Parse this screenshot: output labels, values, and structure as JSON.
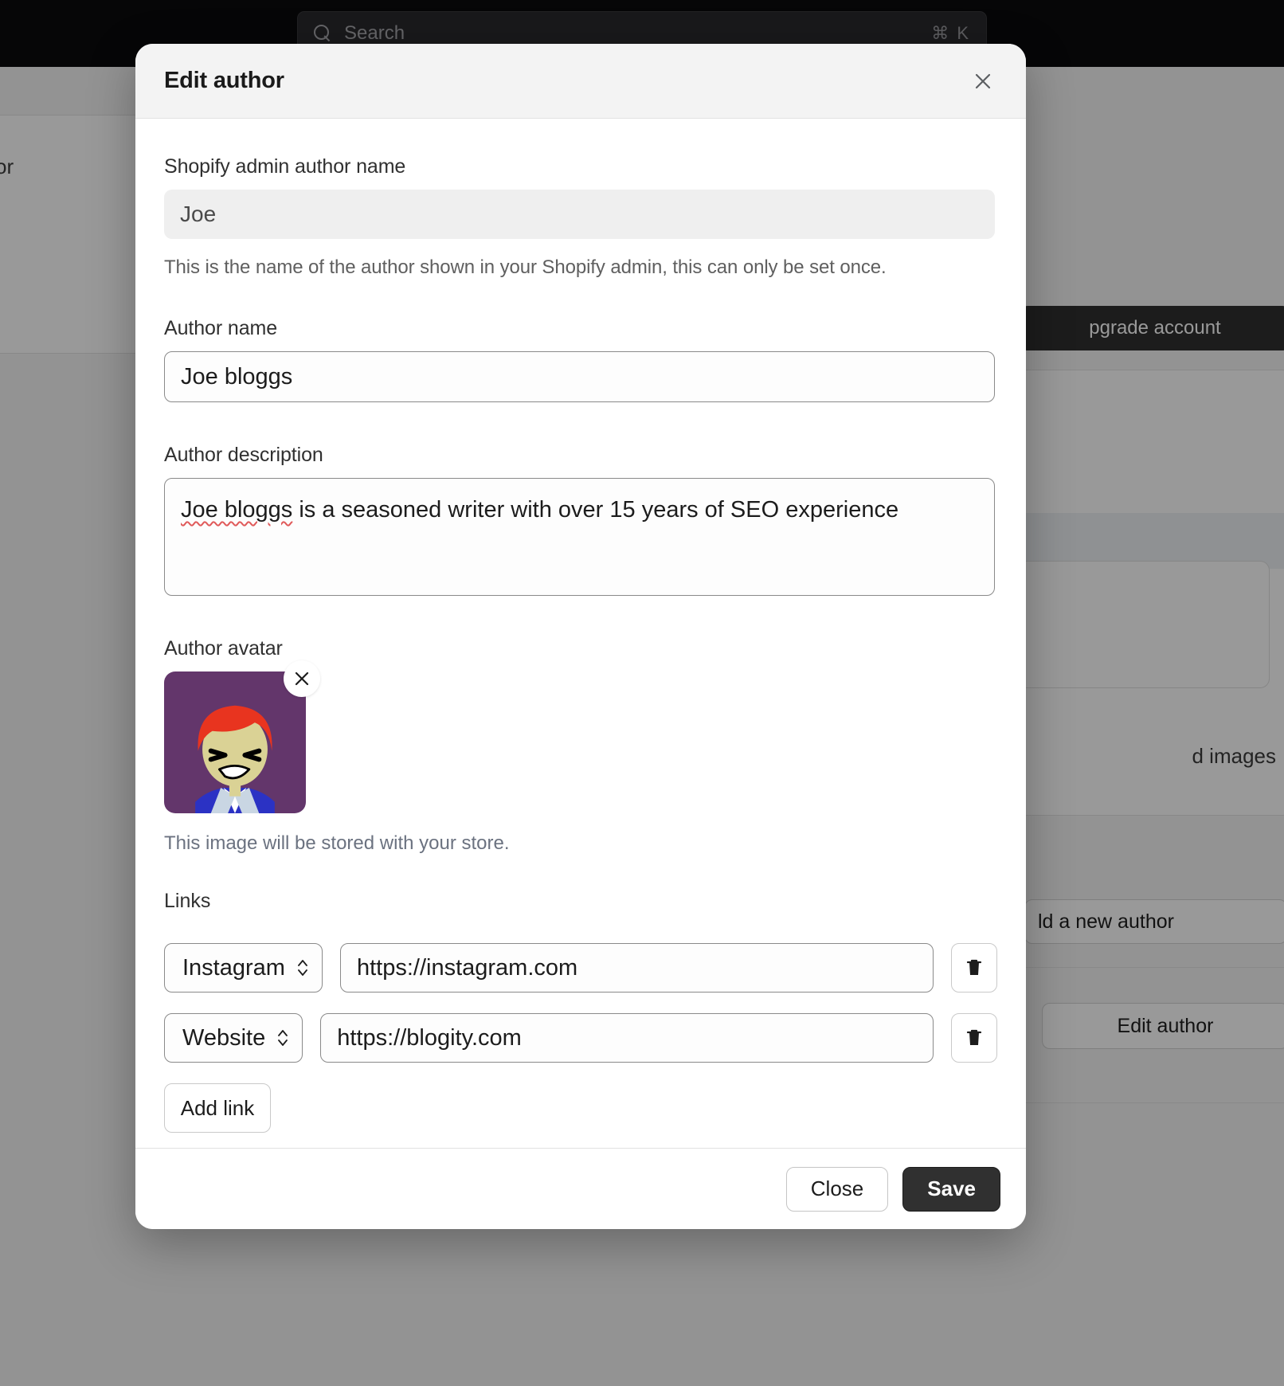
{
  "background": {
    "search": {
      "placeholder": "Search",
      "shortcut": "⌘ K"
    },
    "left_fragment": "or",
    "upgrade_button": "pgrade account",
    "images_text": "d images",
    "new_author_button": "ld a new author",
    "edit_author_button": "Edit author"
  },
  "modal": {
    "title": "Edit author",
    "close_icon": "close-icon",
    "fields": {
      "shopify_admin_author_name": {
        "label": "Shopify admin author name",
        "value": "Joe",
        "help": "This is the name of the author shown in your Shopify admin, this can only be set once."
      },
      "author_name": {
        "label": "Author name",
        "value": "Joe bloggs"
      },
      "author_description": {
        "label": "Author description",
        "value_misspelled": "Joe bloggs",
        "value_rest": " is a seasoned writer with over 15 years of SEO experience",
        "value": "Joe bloggs is a seasoned writer with over 15 years of SEO experience"
      },
      "author_avatar": {
        "label": "Author avatar",
        "note": "This image will be stored with your store.",
        "remove_icon": "close-icon",
        "colors": {
          "background": "#63366b",
          "hair": "#e8341f",
          "skin": "#dad295",
          "shirt": "#ffffff",
          "jacket": "#2b32c4",
          "eyes": "#000000"
        }
      }
    },
    "links": {
      "label": "Links",
      "rows": [
        {
          "type": "Instagram",
          "url": "https://instagram.com",
          "delete_icon": "trash-icon"
        },
        {
          "type": "Website",
          "url": "https://blogity.com",
          "delete_icon": "trash-icon"
        }
      ],
      "add_button": "Add link"
    },
    "footer": {
      "close_label": "Close",
      "save_label": "Save"
    }
  },
  "colors": {
    "accent_dark": "#303030",
    "scrim": "rgba(0,0,0,0.40)",
    "topbar": "#0b0b0c"
  }
}
